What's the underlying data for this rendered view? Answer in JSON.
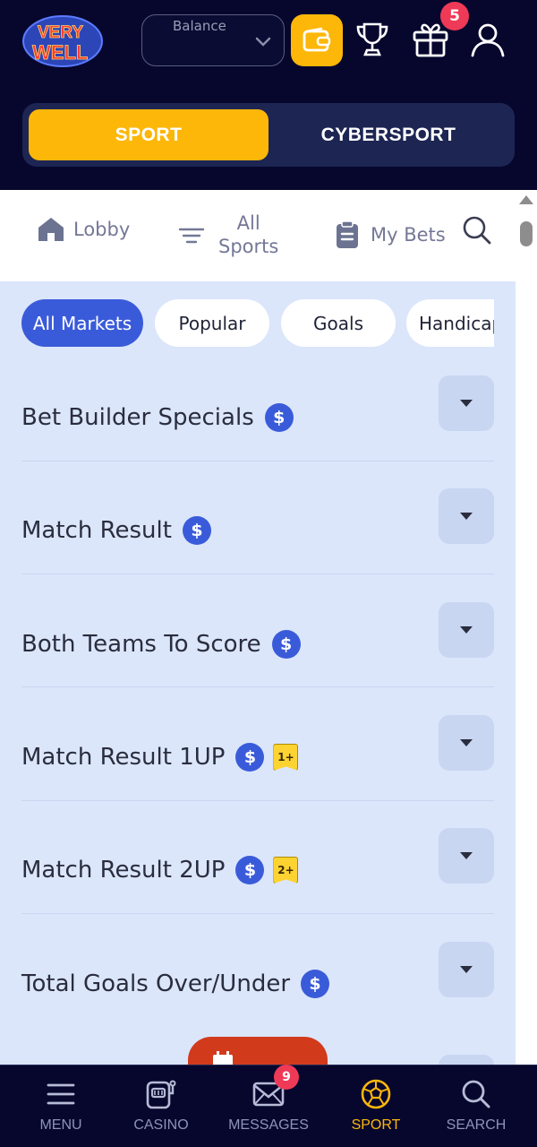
{
  "header": {
    "logo_text": [
      "VERY",
      "WELL"
    ],
    "balance_label": "Balance",
    "gift_badge_count": "5"
  },
  "segment": {
    "sport_label": "SPORT",
    "cybersport_label": "CYBERSPORT",
    "active": "sport"
  },
  "nav": {
    "lobby_label": "Lobby",
    "all_sports_line1": "All",
    "all_sports_line2": "Sports",
    "my_bets_label": "My Bets"
  },
  "chips": [
    {
      "label": "All Markets",
      "active": true
    },
    {
      "label": "Popular",
      "active": false
    },
    {
      "label": "Goals",
      "active": false
    },
    {
      "label": "Handicap",
      "active": false
    }
  ],
  "markets": [
    {
      "title": "Bet Builder Specials",
      "tag": ""
    },
    {
      "title": "Match Result",
      "tag": ""
    },
    {
      "title": "Both Teams To Score",
      "tag": ""
    },
    {
      "title": "Match Result 1UP",
      "tag": "1+"
    },
    {
      "title": "Match Result 2UP",
      "tag": "2+"
    },
    {
      "title": "Total Goals Over/Under",
      "tag": ""
    }
  ],
  "dollar_symbol": "$",
  "bottom_nav": {
    "menu_label": "MENU",
    "casino_label": "CASINO",
    "messages_label": "MESSAGES",
    "messages_badge": "9",
    "sport_label": "SPORT",
    "search_label": "SEARCH",
    "active": "sport"
  },
  "colors": {
    "header_bg": "#07072e",
    "accent_yellow": "#fdb709",
    "accent_blue": "#3a5bd9",
    "badge_red": "#ef3a57",
    "content_bg": "#dbe6fb"
  }
}
